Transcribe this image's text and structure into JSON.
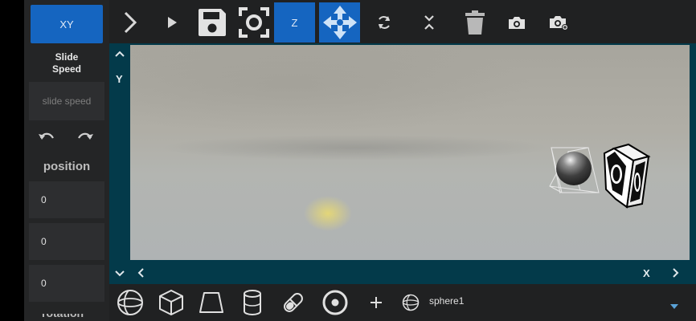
{
  "left_panel": {
    "xy_button": "XY",
    "slide_speed_label": "Slide\nSpeed",
    "slide_speed_placeholder": "slide speed",
    "position_label": "position",
    "position_values": {
      "x": "0",
      "y": "0",
      "z": "0"
    },
    "next_section_label": "rotation"
  },
  "toolbar": {
    "z_button": "Z",
    "icons": [
      "chevron-right-icon",
      "play-icon",
      "save-icon",
      "focus-icon",
      "z-plane-button",
      "move-icon",
      "refresh-icon",
      "collapse-icon",
      "trash-icon",
      "camera-icon",
      "camera-add-icon"
    ]
  },
  "viewport": {
    "y_axis_label": "Y",
    "x_axis_label": "X"
  },
  "bottom_bar": {
    "shapes": [
      "sphere-icon",
      "cube-icon",
      "trapezoid-icon",
      "cylinder-icon",
      "capsule-icon",
      "torus-icon",
      "add-icon"
    ],
    "selected_object_name": "sphere1"
  },
  "colors": {
    "accent": "#1565c0",
    "panel": "#242526",
    "viewport_frame": "#033a4a"
  }
}
